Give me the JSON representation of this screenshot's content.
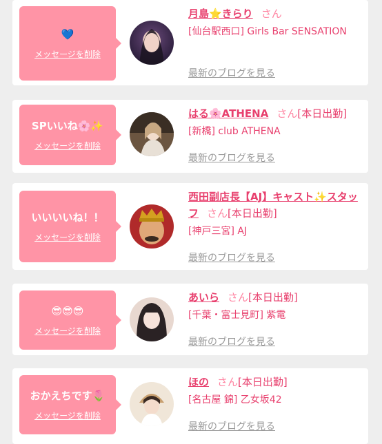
{
  "entries": [
    {
      "message": "💙",
      "delete_label": "メッセージを削除",
      "name": "月島⭐きらり",
      "san": "さん",
      "status": "",
      "shop": "[仙台駅西口] Girls Bar SENSATION",
      "blog_label": "最新のブログを見る",
      "avatar_colors": [
        "#2a1d3a",
        "#6a4a7a"
      ]
    },
    {
      "message": "SPいいね🌸✨",
      "delete_label": "メッセージを削除",
      "name": "はる🌸ATHENA",
      "san": "さん",
      "status": "[本日出勤]",
      "shop": "[新橋] club ATHENA",
      "blog_label": "最新のブログを見る",
      "avatar_colors": [
        "#d8c6b0",
        "#6b5540"
      ]
    },
    {
      "message": "いいいいね！！",
      "delete_label": "メッセージを削除",
      "name": "西田副店長【AJ】キャスト✨スタッフ",
      "san": "さん",
      "status": "[本日出勤]",
      "shop": "[神戸三宮] AJ",
      "blog_label": "最新のブログを見る",
      "avatar_colors": [
        "#b02a2a",
        "#e8b070"
      ]
    },
    {
      "message": "😎😎😎",
      "delete_label": "メッセージを削除",
      "name": "あいら",
      "san": "さん",
      "status": "[本日出勤]",
      "shop": "[千葉・富士見町] 紫電",
      "blog_label": "最新のブログを見る",
      "avatar_colors": [
        "#3a3030",
        "#e8d8d0"
      ]
    },
    {
      "message": "おかえちです🌷",
      "delete_label": "メッセージを削除",
      "name": "ほの",
      "san": "さん",
      "status": "[本日出勤]",
      "shop": "[名古屋 錦] 乙女坂42",
      "blog_label": "最新のブログを見る",
      "avatar_colors": [
        "#f0e6d8",
        "#c8a070"
      ]
    }
  ]
}
